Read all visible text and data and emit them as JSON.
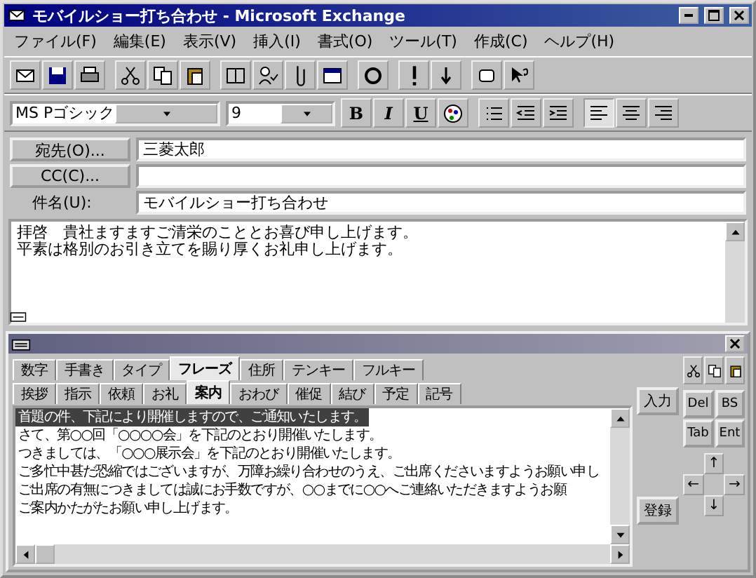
{
  "window": {
    "title": "モバイルショー打ち合わせ - Microsoft Exchange"
  },
  "menu": [
    "ファイル(F)",
    "編集(E)",
    "表示(V)",
    "挿入(I)",
    "書式(O)",
    "ツール(T)",
    "作成(C)",
    "ヘルプ(H)"
  ],
  "format_bar": {
    "font": "MS Pゴシック",
    "size": "9",
    "styles": [
      "B",
      "I",
      "U"
    ],
    "alignment": [
      {
        "kind": "left",
        "selected": true
      },
      {
        "kind": "center",
        "selected": false
      },
      {
        "kind": "right",
        "selected": false
      }
    ]
  },
  "header": {
    "to_button": "宛先(O)...",
    "to": "三菱太郎",
    "cc_button": "CC(C)...",
    "subject_label": "件名(U):",
    "subject": "モバイルショー打ち合わせ"
  },
  "body": [
    "拝啓　貴社ますますご清栄のこととお喜び申し上げます。",
    "平素は格別のお引き立てを賜り厚くお礼申し上げます。"
  ],
  "palette": {
    "tabs": [
      {
        "label": "数字",
        "selected": false
      },
      {
        "label": "手書き",
        "selected": false
      },
      {
        "label": "タイプ",
        "selected": false
      },
      {
        "label": "フレーズ",
        "selected": true
      },
      {
        "label": "住所",
        "selected": false
      },
      {
        "label": "テンキー",
        "selected": false
      },
      {
        "label": "フルキー",
        "selected": false
      }
    ],
    "subtabs": [
      {
        "label": "挨拶",
        "selected": false
      },
      {
        "label": "指示",
        "selected": false
      },
      {
        "label": "依頼",
        "selected": false
      },
      {
        "label": "お礼",
        "selected": false
      },
      {
        "label": "案内",
        "selected": true
      },
      {
        "label": "おわび",
        "selected": false
      },
      {
        "label": "催促",
        "selected": false
      },
      {
        "label": "結び",
        "selected": false
      },
      {
        "label": "予定",
        "selected": false
      },
      {
        "label": "記号",
        "selected": false
      }
    ],
    "phrases": [
      {
        "text": "首題の件、下記により開催しますので、ご通知いたします。",
        "selected": true
      },
      {
        "text": "さて、第○○回「○○○○会」を下記のとおり開催いたします。",
        "selected": false
      },
      {
        "text": "つきましては、「○○○展示会」を下記のとおり開催いたします。",
        "selected": false
      },
      {
        "text": "ご多忙中甚だ恐縮ではございますが、万障お繰り合わせのうえ、ご出席くださいますようお願い申し",
        "selected": false
      },
      {
        "text": "ご出席の有無につきましては誠にお手数ですが、○○までに○○へご連絡いただきますようお願",
        "selected": false
      },
      {
        "text": "ご案内かたがたお願い申し上げます。",
        "selected": false
      }
    ],
    "input_button": "入力",
    "register_button": "登録",
    "keys": [
      "Del",
      "BS",
      "Tab",
      "Ent"
    ],
    "arrows": [
      "↑",
      "←",
      "→",
      "↓"
    ]
  }
}
